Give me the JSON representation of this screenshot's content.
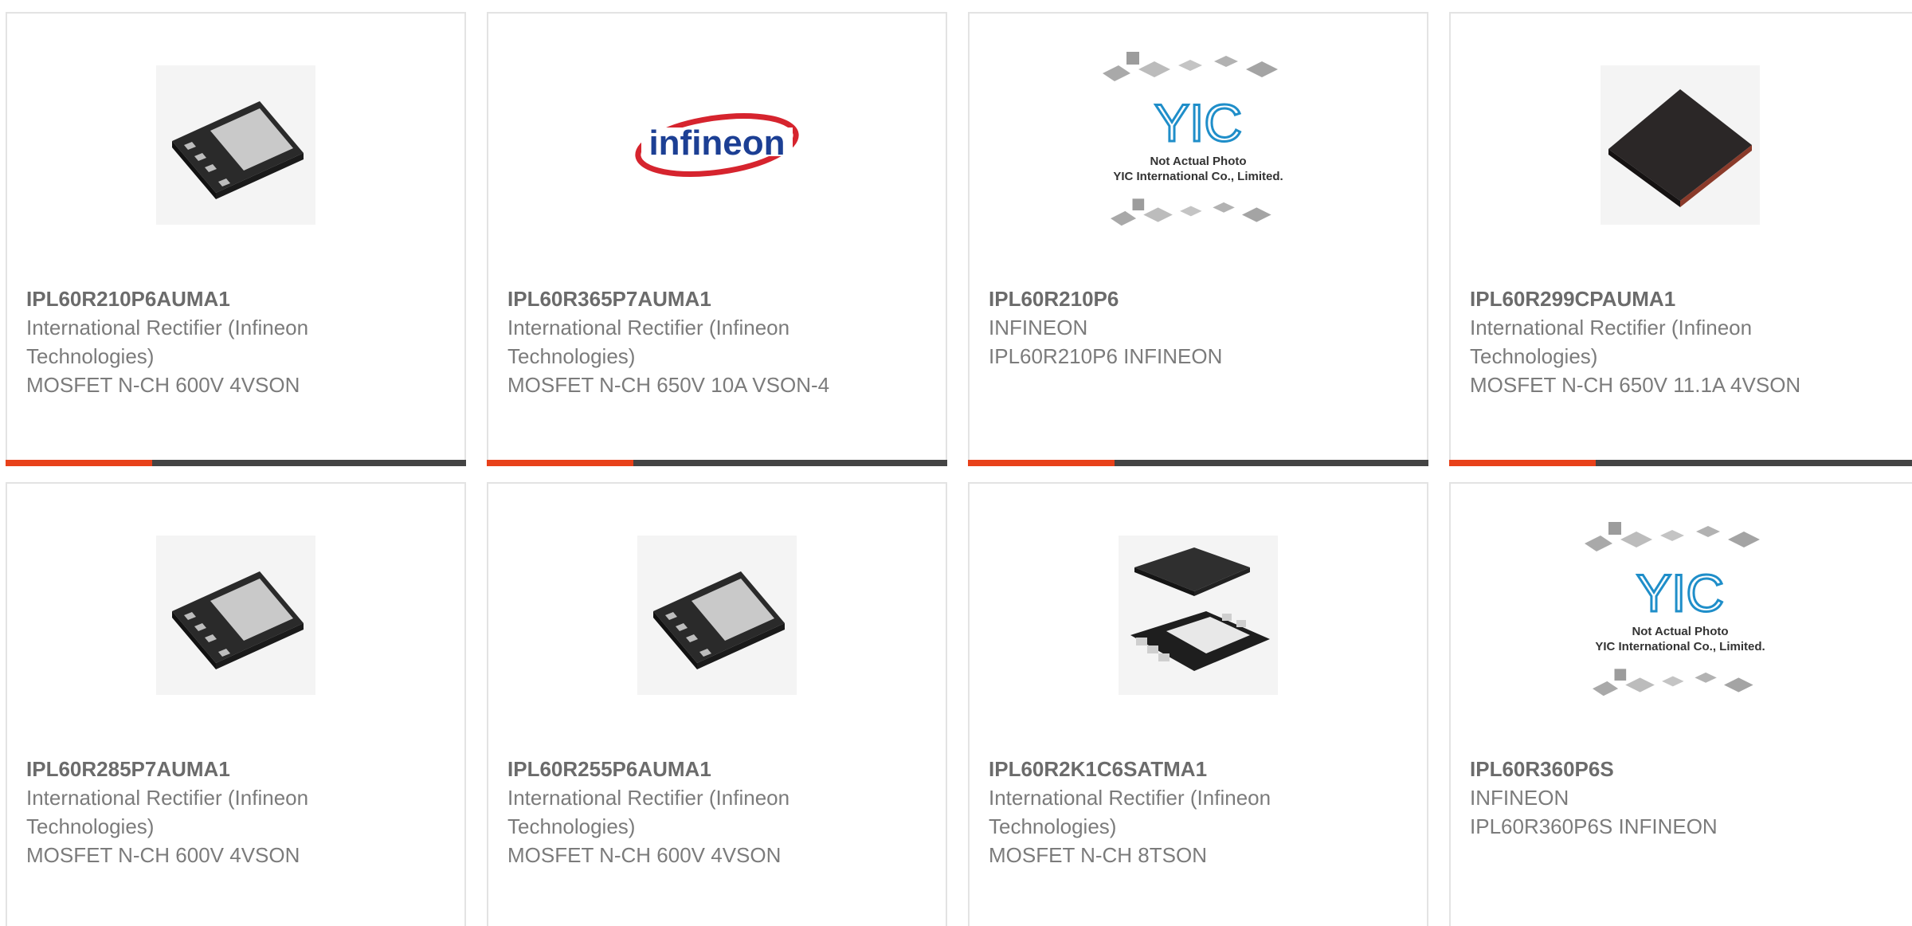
{
  "products": [
    {
      "part_number": "IPL60R210P6AUMA1",
      "manufacturer": "International Rectifier (Infineon Technologies)",
      "description": "MOSFET N-CH 600V 4VSON",
      "image": "vson-chip"
    },
    {
      "part_number": "IPL60R365P7AUMA1",
      "manufacturer": "International Rectifier (Infineon Technologies)",
      "description": "MOSFET N-CH 650V 10A VSON-4",
      "image": "infineon-logo",
      "logo_text": "infineon"
    },
    {
      "part_number": "IPL60R210P6",
      "manufacturer": "INFINEON",
      "description": "IPL60R210P6 INFINEON",
      "image": "yic-placeholder",
      "placeholder_brand": "YIC",
      "placeholder_line1": "Not Actual Photo",
      "placeholder_line2": "YIC International Co., Limited."
    },
    {
      "part_number": "IPL60R299CPAUMA1",
      "manufacturer": "International Rectifier (Infineon Technologies)",
      "description": "MOSFET N-CH 650V 11.1A 4VSON",
      "image": "black-package"
    },
    {
      "part_number": "IPL60R285P7AUMA1",
      "manufacturer": "International Rectifier (Infineon Technologies)",
      "description": "MOSFET N-CH 600V 4VSON",
      "image": "vson-chip"
    },
    {
      "part_number": "IPL60R255P6AUMA1",
      "manufacturer": "International Rectifier (Infineon Technologies)",
      "description": "MOSFET N-CH 600V 4VSON",
      "image": "vson-chip"
    },
    {
      "part_number": "IPL60R2K1C6SATMA1",
      "manufacturer": "International Rectifier (Infineon Technologies)",
      "description": "MOSFET N-CH 8TSON",
      "image": "tson-pair"
    },
    {
      "part_number": "IPL60R360P6S",
      "manufacturer": "INFINEON",
      "description": "IPL60R360P6S INFINEON",
      "image": "yic-placeholder",
      "placeholder_brand": "YIC",
      "placeholder_line1": "Not Actual Photo",
      "placeholder_line2": "YIC International Co., Limited."
    }
  ],
  "colors": {
    "accent": "#e8411a",
    "bar": "#444444",
    "title_text": "#6b6b6b",
    "body_text": "#7b7b7b",
    "card_border": "#e3e3e3"
  }
}
